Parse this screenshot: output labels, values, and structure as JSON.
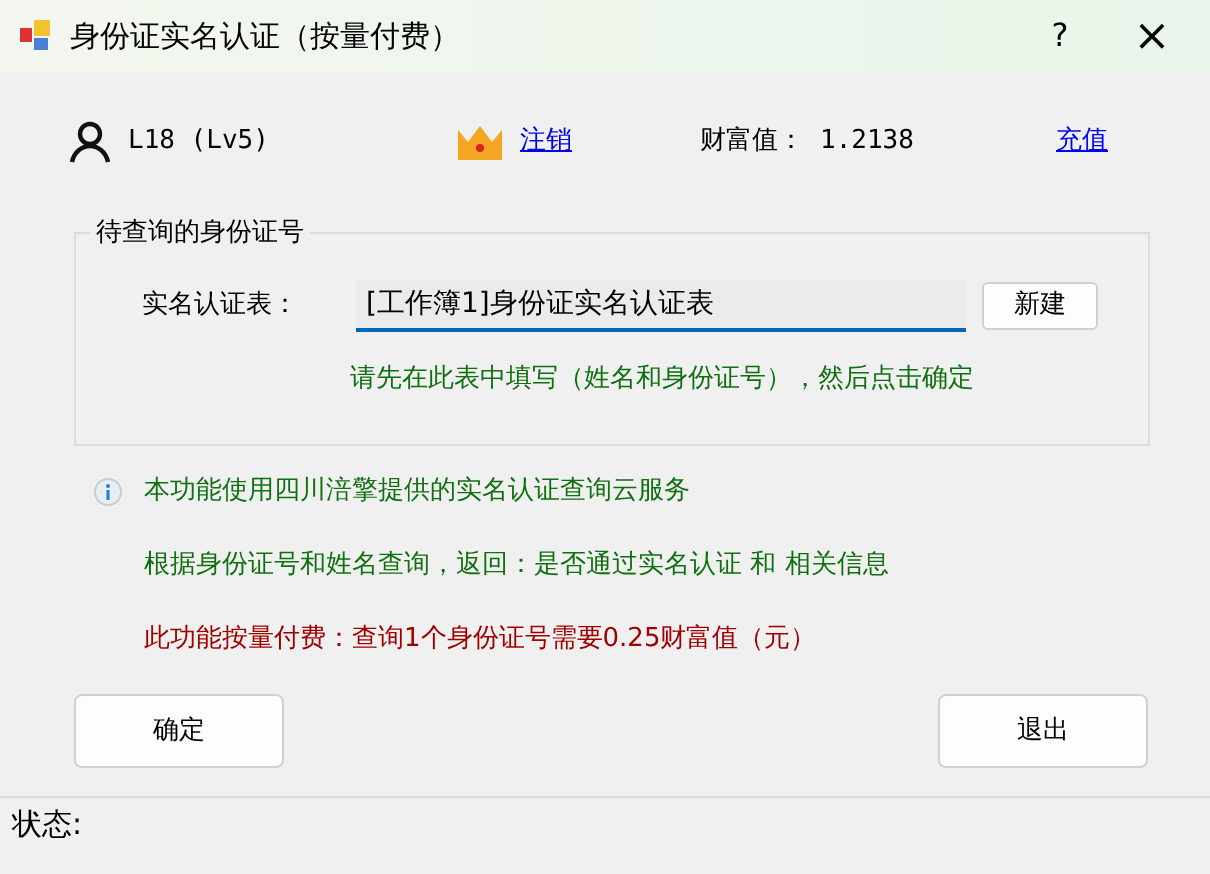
{
  "window": {
    "title": "身份证实名认证（按量付费）",
    "help": "?",
    "close": "×"
  },
  "account": {
    "user": "L18 (Lv5)",
    "logout": "注销",
    "balance_label": "财富值：",
    "balance": "1.2138",
    "recharge": "充值"
  },
  "group": {
    "title": "待查询的身份证号",
    "field_label": "实名认证表：",
    "value": "[工作簿1]身份证实名认证表",
    "new_button": "新建",
    "hint": "请先在此表中填写（姓名和身份证号），然后点击确定"
  },
  "info": [
    {
      "kind": "info",
      "text": "本功能使用四川涪擎提供的实名认证查询云服务"
    },
    {
      "kind": "note",
      "text": "根据身份证号和姓名查询，返回：是否通过实名认证 和 相关信息"
    },
    {
      "kind": "fee",
      "text": "此功能按量付费：查询1个身份证号需要0.25财富值（元）"
    }
  ],
  "buttons": [
    "确定",
    "退出"
  ],
  "status_bar": {
    "label": "状态:"
  }
}
